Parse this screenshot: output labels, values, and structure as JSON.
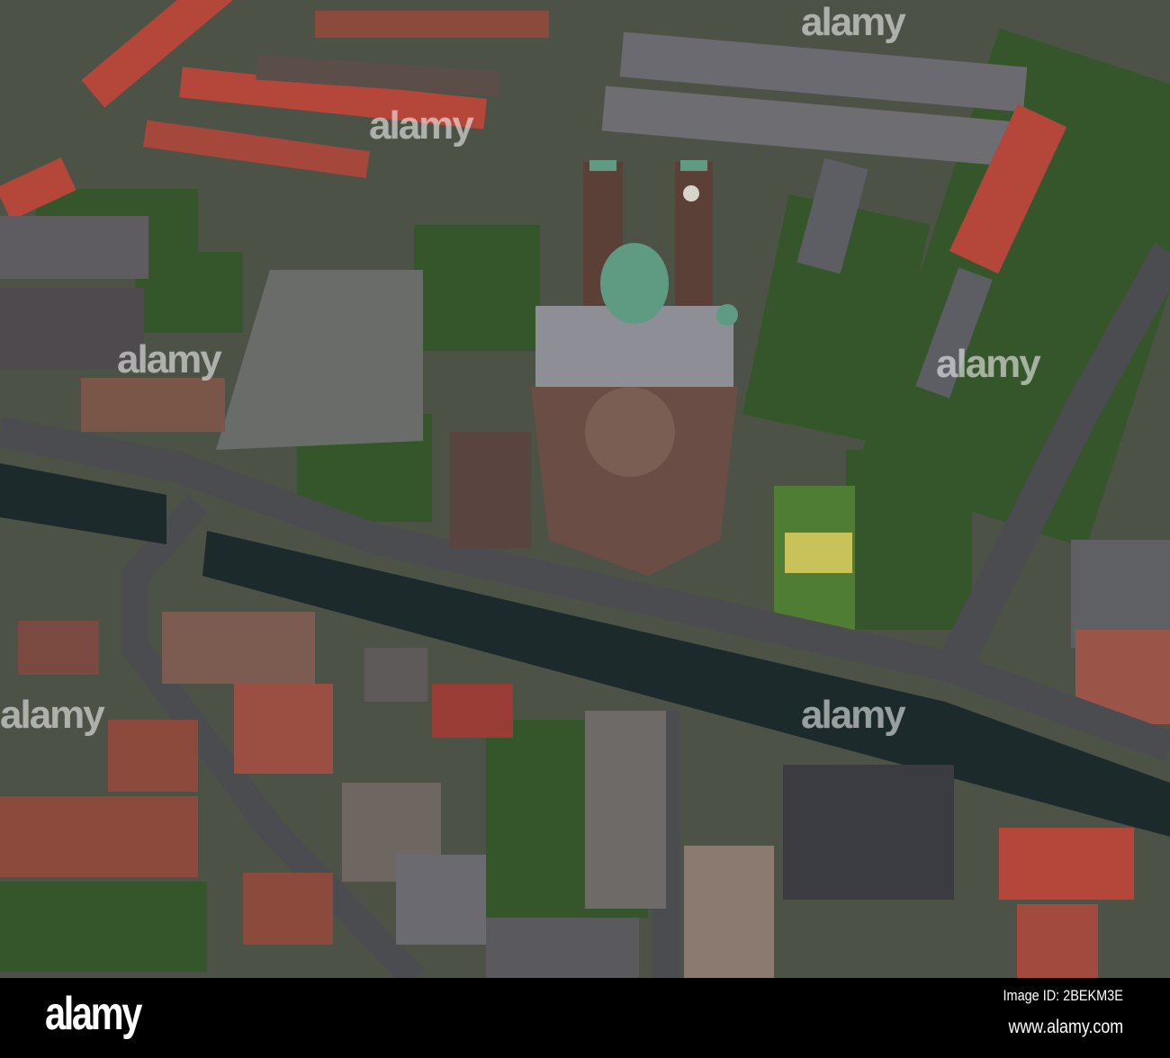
{
  "watermark": {
    "text": "alamy"
  },
  "footer": {
    "logo": "alamy",
    "image_id": "Image ID: 2BEKM3E",
    "url": "www.alamy.com"
  },
  "colors": {
    "dome": "#5f9a83",
    "canal": "#1c2a2c",
    "road": "#4a4c50",
    "roof_red": "#b4463a",
    "grass": "#3f6a2c"
  }
}
